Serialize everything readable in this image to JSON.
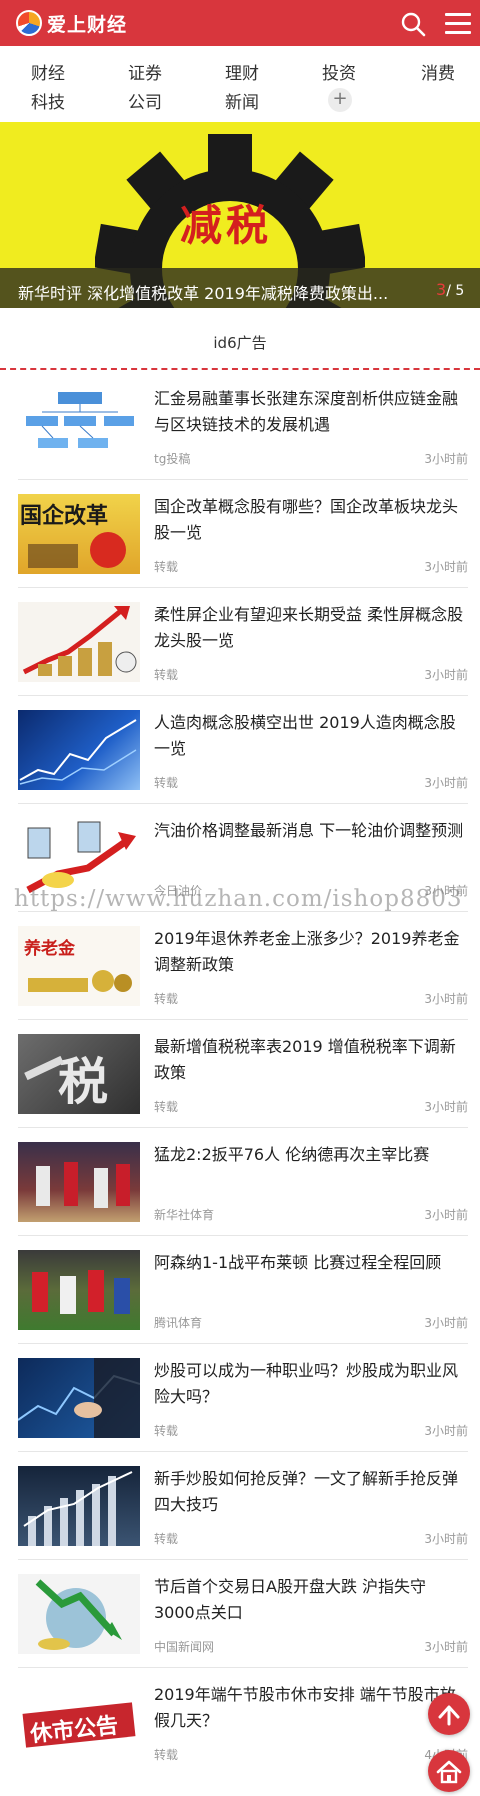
{
  "header": {
    "brand": "爱上财经",
    "icons": [
      "search-icon",
      "menu-icon"
    ],
    "color": "#d8363d"
  },
  "nav": {
    "items": [
      "财经",
      "证券",
      "理财",
      "投资",
      "消费",
      "科技",
      "公司",
      "新闻"
    ],
    "more": "+"
  },
  "banner": {
    "badge_text": "减税",
    "title": "新华时评 深化增值税改革 2019年减税降费政策出...",
    "current": "3",
    "total": "/ 5"
  },
  "ad": {
    "text": "id6广告"
  },
  "articles": [
    {
      "title": "汇金易融董事长张建东深度剖析供应链金融与区块链技术的发展机遇",
      "source": "tg投稿",
      "time": "3小时前"
    },
    {
      "title": "国企改革概念股有哪些？国企改革板块龙头股一览",
      "source": "转载",
      "time": "3小时前",
      "thumb_text": "国企改革"
    },
    {
      "title": "柔性屏企业有望迎来长期受益 柔性屏概念股龙头股一览",
      "source": "转载",
      "time": "3小时前"
    },
    {
      "title": "人造肉概念股横空出世 2019人造肉概念股一览",
      "source": "转载",
      "time": "3小时前"
    },
    {
      "title": "汽油价格调整最新消息 下一轮油价调整预测",
      "source": "今日油价",
      "time": "3小时前"
    },
    {
      "title": "2019年退休养老金上涨多少？2019养老金调整新政策",
      "source": "转载",
      "time": "3小时前",
      "thumb_text": "养老金"
    },
    {
      "title": "最新增值税税率表2019 增值税税率下调新政策",
      "source": "转载",
      "time": "3小时前",
      "thumb_text": "税"
    },
    {
      "title": "猛龙2:2扳平76人 伦纳德再次主宰比赛",
      "source": "新华社体育",
      "time": "3小时前"
    },
    {
      "title": "阿森纳1-1战平布莱顿 比赛过程全程回顾",
      "source": "腾讯体育",
      "time": "3小时前"
    },
    {
      "title": "炒股可以成为一种职业吗？炒股成为职业风险大吗？",
      "source": "转载",
      "time": "3小时前"
    },
    {
      "title": "新手炒股如何抢反弹？一文了解新手抢反弹四大技巧",
      "source": "转载",
      "time": "3小时前"
    },
    {
      "title": "节后首个交易日A股开盘大跌 沪指失守3000点关口",
      "source": "中国新闻网",
      "time": "3小时前"
    },
    {
      "title": "2019年端午节股市休市安排 端午节股市放假几天？",
      "source": "转载",
      "time": "4小时前",
      "thumb_text": "休市公告"
    }
  ],
  "watermark": "https://www.huzhan.com/ishop8803",
  "fab": {
    "icons": [
      "arrow-up-icon",
      "home-icon"
    ]
  }
}
